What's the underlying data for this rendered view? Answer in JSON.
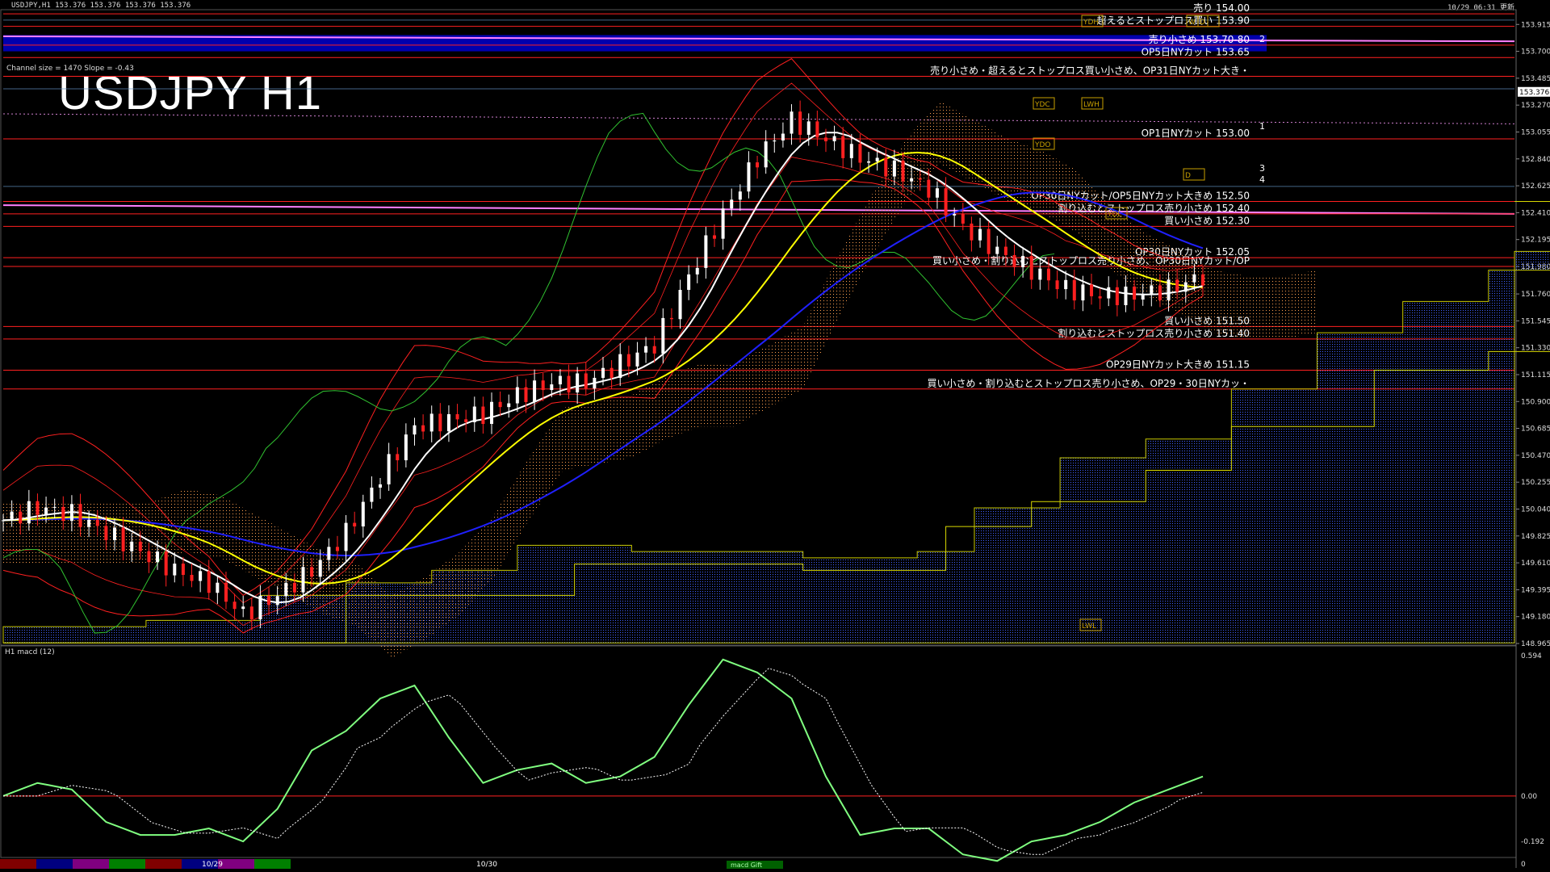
{
  "header": {
    "symbol_line": "USDJPY,H1  153.376 153.376 153.376 153.376",
    "datetime": "10/29 06:31 更新",
    "channel_info": "Channel size = 1470 Slope = -0.43",
    "big_title": "USDJPY H1",
    "current_price": "153.376"
  },
  "price_axis": [
    "153.915",
    "153.700",
    "153.485",
    "153.270",
    "153.055",
    "152.840",
    "152.625",
    "152.410",
    "152.195",
    "151.980",
    "151.760",
    "151.545",
    "151.330",
    "151.115",
    "150.900",
    "150.685",
    "150.470",
    "150.255",
    "150.040",
    "149.825",
    "149.610",
    "149.395",
    "149.180",
    "148.965"
  ],
  "macd_axis": [
    "0.594",
    "0.00",
    "-0.192",
    "0"
  ],
  "macd_label": "H1  macd (12)",
  "bottom_axis": [
    "10/29",
    "10/30"
  ],
  "bottom_center_label": "macd Gift",
  "level_labels": [
    {
      "text": "売り 154.00",
      "price": 154.0,
      "color": "#ff3030"
    },
    {
      "text": "超えるとストップロス買い 153.90",
      "price": 153.9,
      "color": "#ff3030"
    },
    {
      "text": "売り小さめ 153.70-80",
      "price": 153.75,
      "color": "#ff3030"
    },
    {
      "text": "OP5日NYカット 153.65",
      "price": 153.65,
      "color": "#ff3030"
    },
    {
      "text": "売り小さめ・超えるとストップロス買い小さめ、OP31日NYカット大き・",
      "price": 153.5,
      "color": "#ff3030"
    },
    {
      "text": "OP1日NYカット 153.00",
      "price": 153.0,
      "color": "#ff3030"
    },
    {
      "text": "OP30日NYカット/OP5日NYカット大きめ 152.50",
      "price": 152.5,
      "color": "#ff3030"
    },
    {
      "text": "割り込むとストップロス売り小さめ 152.40",
      "price": 152.4,
      "color": "#ff3030"
    },
    {
      "text": "買い小さめ 152.30",
      "price": 152.3,
      "color": "#ff3030"
    },
    {
      "text": "OP30日NYカット 152.05",
      "price": 152.05,
      "color": "#ff3030"
    },
    {
      "text": "買い小さめ・割り込むとストップロス売り小さめ、OP30日NYカット/OP",
      "price": 151.98,
      "color": "#ff3030"
    },
    {
      "text": "買い小さめ 151.50",
      "price": 151.5,
      "color": "#ff3030"
    },
    {
      "text": "割り込むとストップロス売り小さめ 151.40",
      "price": 151.4,
      "color": "#ff3030"
    },
    {
      "text": "OP29日NYカット大きめ 151.15",
      "price": 151.15,
      "color": "#ff3030"
    },
    {
      "text": "買い小さめ・割り込むとストップロス売り小さめ、OP29・30日NYカッ・",
      "price": 151.0,
      "color": "#ff3030"
    }
  ],
  "box_labels": [
    "YDH",
    "W",
    "D",
    "YDC",
    "LWH",
    "YDO",
    "YDL",
    "LWL",
    "D"
  ],
  "channel_numbers": [
    "1",
    "2",
    "3",
    "4"
  ],
  "chart_data": {
    "type": "candlestick",
    "title": "USDJPY H1",
    "ylim": [
      148.965,
      154.02
    ],
    "x_range_hours": [
      0,
      210
    ],
    "day_markers": [
      {
        "label": "10/29",
        "x": 115
      },
      {
        "label": "10/30",
        "x": 280
      }
    ],
    "colors": {
      "up": "#ffffff",
      "down": "#ff2020",
      "sma_fast": "#ffffff",
      "sma_mid": "#ffff00",
      "sma_slow": "#2020ff",
      "bollinger": "#ff2020",
      "lagging": "#30c030",
      "kumo_a": "#ffa050",
      "kumo_b": "#4060ff",
      "macd": "#80ff80",
      "macd_down": "#ff80a0",
      "signal": "#ffffff",
      "level_line": "#ff2020",
      "band_highlight": "#0000cc"
    },
    "price_path": [
      [
        0,
        149.95
      ],
      [
        6,
        150.05
      ],
      [
        12,
        150.0
      ],
      [
        18,
        149.85
      ],
      [
        24,
        149.7
      ],
      [
        30,
        149.55
      ],
      [
        36,
        149.45
      ],
      [
        42,
        149.2
      ],
      [
        48,
        149.35
      ],
      [
        54,
        149.55
      ],
      [
        60,
        149.85
      ],
      [
        66,
        150.3
      ],
      [
        72,
        150.7
      ],
      [
        78,
        150.75
      ],
      [
        84,
        150.8
      ],
      [
        90,
        150.95
      ],
      [
        96,
        151.05
      ],
      [
        102,
        151.05
      ],
      [
        108,
        151.2
      ],
      [
        114,
        151.35
      ],
      [
        120,
        151.9
      ],
      [
        126,
        152.4
      ],
      [
        132,
        152.85
      ],
      [
        138,
        153.15
      ],
      [
        144,
        153.0
      ],
      [
        150,
        152.85
      ],
      [
        156,
        152.75
      ],
      [
        162,
        152.6
      ],
      [
        168,
        152.3
      ],
      [
        174,
        152.1
      ],
      [
        180,
        151.95
      ],
      [
        186,
        151.8
      ],
      [
        192,
        151.75
      ],
      [
        198,
        151.75
      ],
      [
        204,
        151.8
      ],
      [
        210,
        151.9
      ]
    ]
  }
}
